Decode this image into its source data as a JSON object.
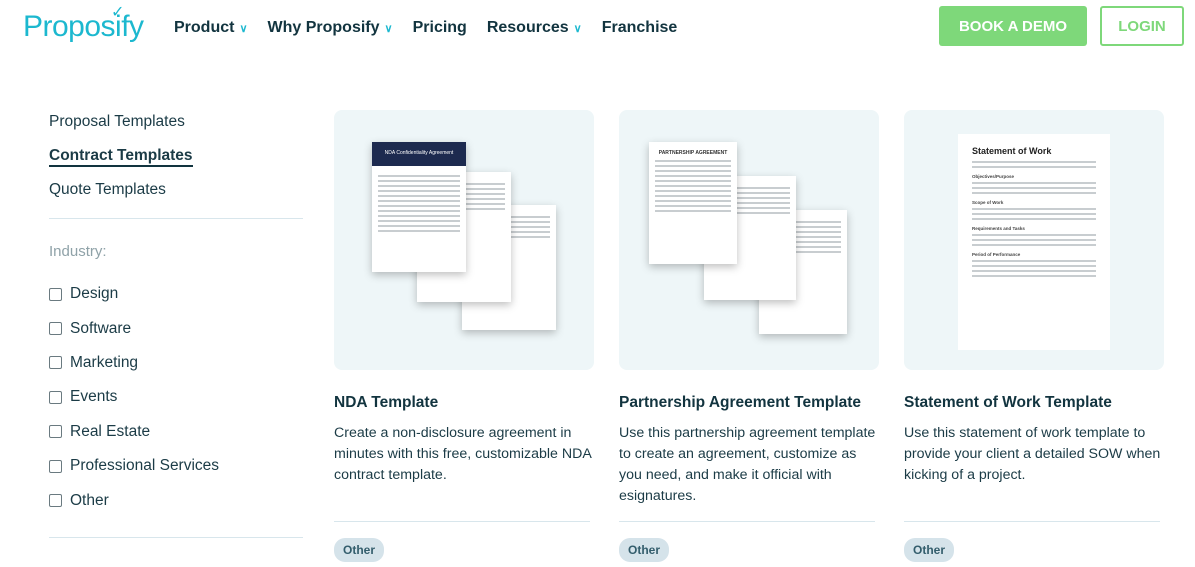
{
  "nav": {
    "logo": "Proposify",
    "items": [
      {
        "label": "Product",
        "dropdown": true
      },
      {
        "label": "Why Proposify",
        "dropdown": true
      },
      {
        "label": "Pricing",
        "dropdown": false
      },
      {
        "label": "Resources",
        "dropdown": true
      },
      {
        "label": "Franchise",
        "dropdown": false
      }
    ],
    "demo": "BOOK A DEMO",
    "login": "LOGIN"
  },
  "sidebar": {
    "categories": [
      "Proposal Templates",
      "Contract Templates",
      "Quote Templates"
    ],
    "active": "Contract Templates",
    "industry_label": "Industry:",
    "industries": [
      "Design",
      "Software",
      "Marketing",
      "Events",
      "Real Estate",
      "Professional Services",
      "Other"
    ]
  },
  "cards": [
    {
      "title": "NDA Template",
      "desc": "Create a non-disclosure agreement in minutes with this free, customizable NDA contract template.",
      "tag": "Other",
      "doc_heading": "NDA Confidentiality Agreement"
    },
    {
      "title": "Partnership Agreement Template",
      "desc": "Use this partnership agreement template to create an agreement, customize as you need, and make it official with esignatures.",
      "tag": "Other",
      "doc_heading": "PARTNERSHIP AGREEMENT"
    },
    {
      "title": "Statement of Work Template",
      "desc": "Use this statement of work template to provide your client a detailed SOW when kicking of a project.",
      "tag": "Other",
      "doc_heading": "Statement of Work",
      "doc_sections": [
        "Objectives/Purpose",
        "Scope of Work",
        "Requirements and Tasks",
        "Period of Performance"
      ]
    }
  ],
  "colors": {
    "brand": "#1cb8cf",
    "cta": "#7ed87a",
    "text": "#12343f"
  }
}
